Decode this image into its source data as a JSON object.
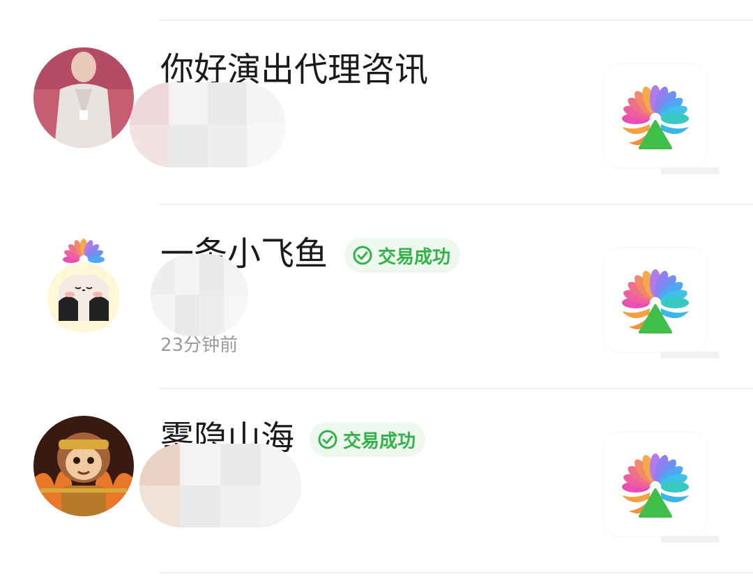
{
  "rows": [
    {
      "name": "你好演出代理咨讯",
      "time": "",
      "badge": ""
    },
    {
      "name": "一条小飞鱼",
      "time": "23分钟前",
      "badge": "交易成功"
    },
    {
      "name": "雾隐山海",
      "time": "",
      "badge": "交易成功"
    }
  ],
  "colors": {
    "badge_text": "#34b24a",
    "badge_bg": "#eef8ef",
    "divider": "#f0f0f0",
    "name_text": "#1a1a1a",
    "time_text": "#9a9a9a"
  },
  "icons": {
    "avatar_1": "person-photo-avatar",
    "avatar_2": "cartoon-face-avatar",
    "avatar_3": "monkey-king-avatar",
    "item_thumb": "colorful-flower-logo-icon",
    "badge": "check-circle-icon"
  }
}
